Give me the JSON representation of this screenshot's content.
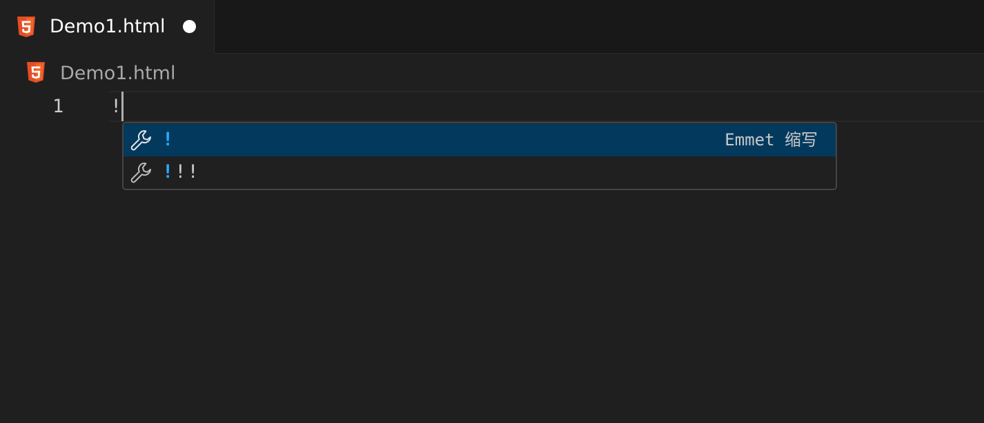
{
  "tabbar": {
    "active_tab": {
      "label": "Demo1.html",
      "icon": "html5-icon",
      "dirty": true
    }
  },
  "breadcrumb": {
    "file": "Demo1.html",
    "icon": "html5-icon"
  },
  "editor": {
    "lines": [
      {
        "number": "1",
        "text": "!"
      }
    ]
  },
  "suggest": {
    "items": [
      {
        "icon": "wrench-icon",
        "match": "!",
        "rest": "",
        "detail": "Emmet 缩写",
        "selected": true
      },
      {
        "icon": "wrench-icon",
        "match": "!",
        "rest": "!!",
        "detail": "",
        "selected": false
      }
    ]
  },
  "colors": {
    "html_icon": "#e44d26",
    "selection": "#04395e",
    "match_highlight": "#2aaaff",
    "editor_background": "#1f1f1f"
  }
}
